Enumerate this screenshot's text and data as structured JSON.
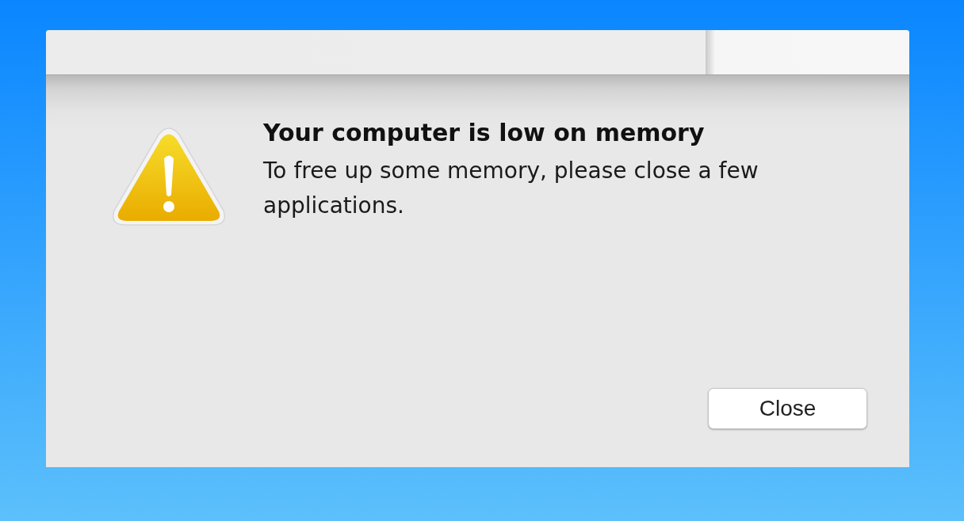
{
  "dialog": {
    "title": "Your computer is low on memory",
    "message": "To free up some memory, please close a few applications.",
    "buttons": [
      {
        "label": "Close"
      }
    ]
  }
}
